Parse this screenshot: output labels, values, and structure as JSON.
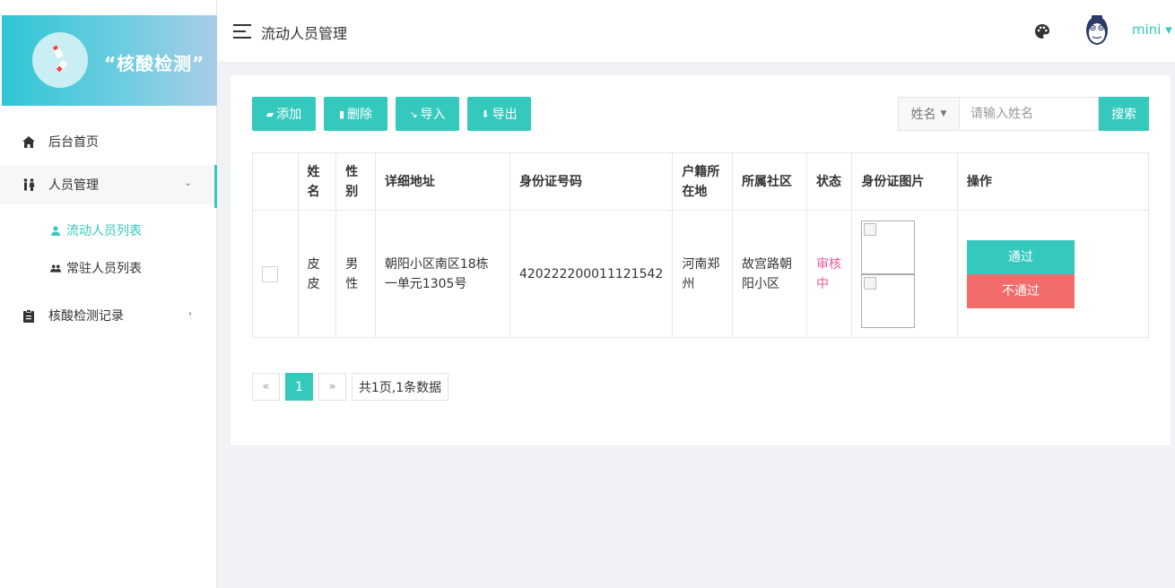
{
  "brand": {
    "title": "“核酸检测”"
  },
  "sidebar": {
    "items": [
      {
        "label": "后台首页"
      },
      {
        "label": "人员管理"
      },
      {
        "label": "核酸检测记录"
      }
    ],
    "submenu": [
      {
        "label": "流动人员列表"
      },
      {
        "label": "常驻人员列表"
      }
    ]
  },
  "header": {
    "title": "流动人员管理",
    "user": "mini ▾"
  },
  "toolbar": {
    "add": "添加",
    "delete": "删除",
    "import": "导入",
    "export": "导出"
  },
  "search": {
    "field": "姓名",
    "placeholder": "请输入姓名",
    "button": "搜索"
  },
  "table": {
    "headers": [
      "姓名",
      "性别",
      "详细地址",
      "身份证号码",
      "户籍所在地",
      "所属社区",
      "状态",
      "身份证图片",
      "操作"
    ],
    "rows": [
      {
        "name": "皮皮",
        "gender": "男性",
        "address": "朝阳小区南区18栋一单元1305号",
        "id_number": "420222200011121542",
        "hukou": "河南郑州",
        "community": "故宫路朝阳小区",
        "status": "审核中",
        "approve": "通过",
        "reject": "不通过"
      }
    ]
  },
  "pagination": {
    "prev": "«",
    "current": "1",
    "next": "»",
    "summary": "共1页,1条数据"
  },
  "colors": {
    "accent": "#35c9bd",
    "danger": "#f26c6c",
    "status_pending": "#e85b9c"
  }
}
